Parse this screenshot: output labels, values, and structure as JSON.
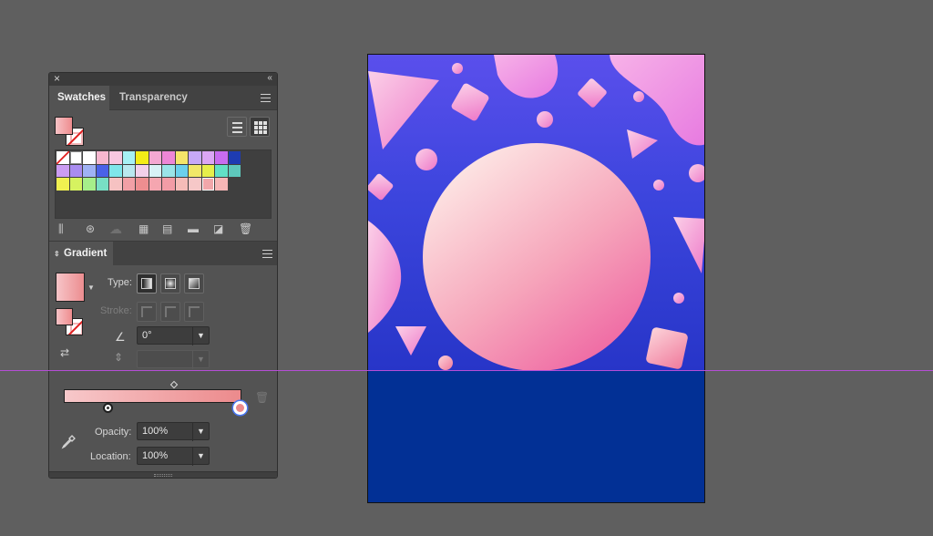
{
  "panel": {
    "close_label": "×",
    "collapse_label": "‹‹",
    "tabs": [
      {
        "label": "Swatches",
        "active": true
      },
      {
        "label": "Transparency",
        "active": false
      }
    ],
    "swatches": [
      "none",
      "registration",
      "#ffffff",
      "#f6b7cf",
      "#f8c7e0",
      "#a6f0f4",
      "#f3ec17",
      "#f4a8d2",
      "#ee86d6",
      "#f4e56a",
      "#c7a9f6",
      "#dba6f4",
      "#c86cf0",
      "#1e3cb2",
      "",
      "#cb9cf2",
      "#a98cf0",
      "#9fb2f5",
      "#4a62e8",
      "#7fe6ea",
      "#b9e8ef",
      "#f2d0ea",
      "#d8f2f6",
      "#9ae4e8",
      "#6bd0ec",
      "#f1e868",
      "#e6ef4a",
      "#62e0c6",
      "#5ec8bc",
      "",
      "#f0f050",
      "#d6f260",
      "#a6ef8a",
      "#78dfc4",
      "#f6c2c2",
      "#f2a0a6",
      "#ee8e90",
      "#f5a6b0",
      "#f29ca6",
      "#f5bcb8",
      "#f6c8c8",
      "#f1a7aa",
      "#f6b6b6",
      "",
      ""
    ],
    "selected_swatch_index": 41,
    "gradient": {
      "title": "Gradient",
      "type_label": "Type:",
      "stroke_label": "Stroke:",
      "angle_value": "0°",
      "aspect_value": "",
      "opacity_label": "Opacity:",
      "opacity_value": "100%",
      "location_label": "Location:",
      "location_value": "100%",
      "start_color": "#f7c8ca",
      "end_color": "#ec8a8c"
    }
  },
  "artboard": {
    "background_top": "#3e3ce6",
    "background_bottom": "#023095",
    "circle_colors": [
      "#fce0e4",
      "#f06ca0"
    ]
  },
  "colors": {
    "app_bg": "#5f5f5f",
    "guide": "#b54dd6",
    "panel_bg": "#535353"
  }
}
